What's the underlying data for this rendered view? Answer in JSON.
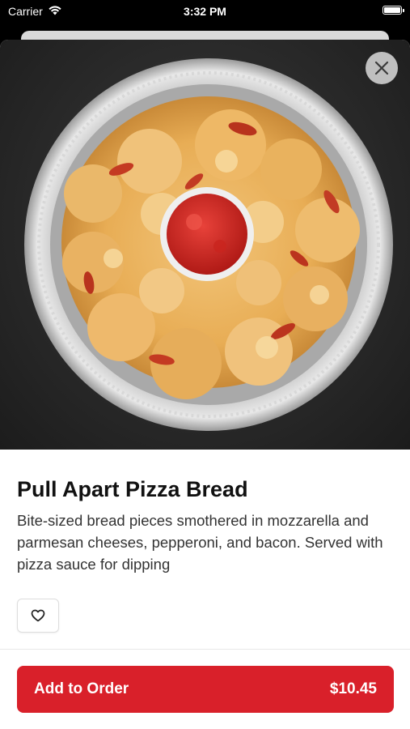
{
  "status_bar": {
    "carrier": "Carrier",
    "time": "3:32 PM"
  },
  "product": {
    "name": "Pull Apart Pizza Bread",
    "description": "Bite-sized bread pieces smothered in mozzarella and parmesan cheeses, pepperoni, and bacon. Served with pizza sauce for dipping",
    "image_icon": "pizza-bread-photo"
  },
  "actions": {
    "close_icon": "close-icon",
    "favorite_icon": "heart-icon",
    "add_label": "Add to Order",
    "price": "$10.45"
  },
  "colors": {
    "accent": "#d9202a"
  }
}
